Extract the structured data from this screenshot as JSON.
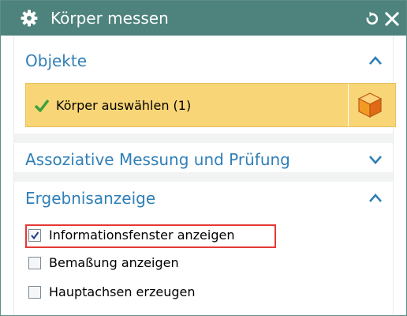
{
  "window": {
    "title": "Körper messen",
    "icons": {
      "gear": "gear-icon",
      "reset": "reset-icon",
      "close": "close-icon"
    },
    "colors": {
      "titlebar": "#4d837c",
      "section_title": "#2f7fb7",
      "selection_bg": "#f8d576",
      "highlight": "#e53935"
    }
  },
  "sections": {
    "objects": {
      "title": "Objekte",
      "expanded": true,
      "selection": {
        "label": "Körper auswählen (1)"
      }
    },
    "associative": {
      "title": "Assoziative Messung und Prüfung",
      "expanded": false
    },
    "results": {
      "title": "Ergebnisanzeige",
      "expanded": true,
      "options": [
        {
          "label": "Informationsfenster anzeigen",
          "checked": true
        },
        {
          "label": "Bemaßung anzeigen",
          "checked": false
        },
        {
          "label": "Hauptachsen erzeugen",
          "checked": false
        }
      ]
    }
  }
}
